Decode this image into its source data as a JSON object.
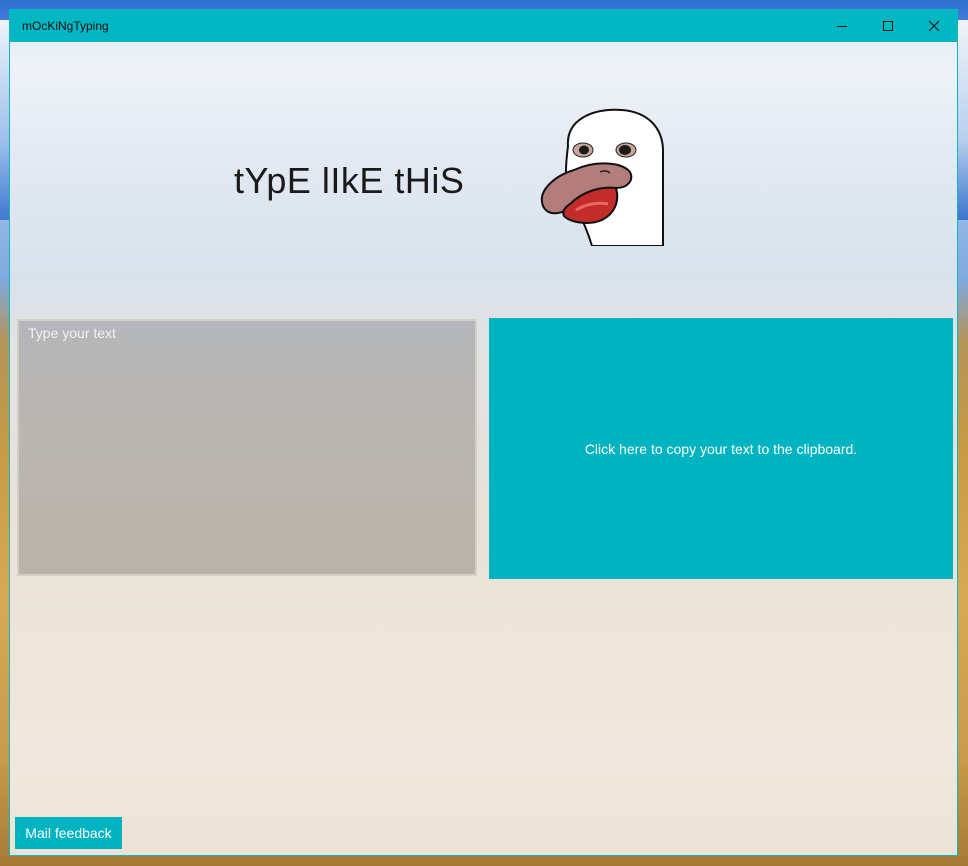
{
  "window": {
    "title": "mOcKiNgTyping",
    "accent_color": "#00b7c3",
    "caption_buttons": {
      "minimize_icon": "minimize-icon",
      "maximize_icon": "maximize-icon",
      "close_icon": "close-icon"
    }
  },
  "header": {
    "headline": "tYpE lIkE tHiS",
    "mascot_image": "mocking-seagull-image"
  },
  "editor": {
    "placeholder": "Type your text",
    "value": ""
  },
  "copy_panel": {
    "label": "Click here to copy your text to the clipboard."
  },
  "footer": {
    "mail_feedback_label": "Mail feedback"
  }
}
